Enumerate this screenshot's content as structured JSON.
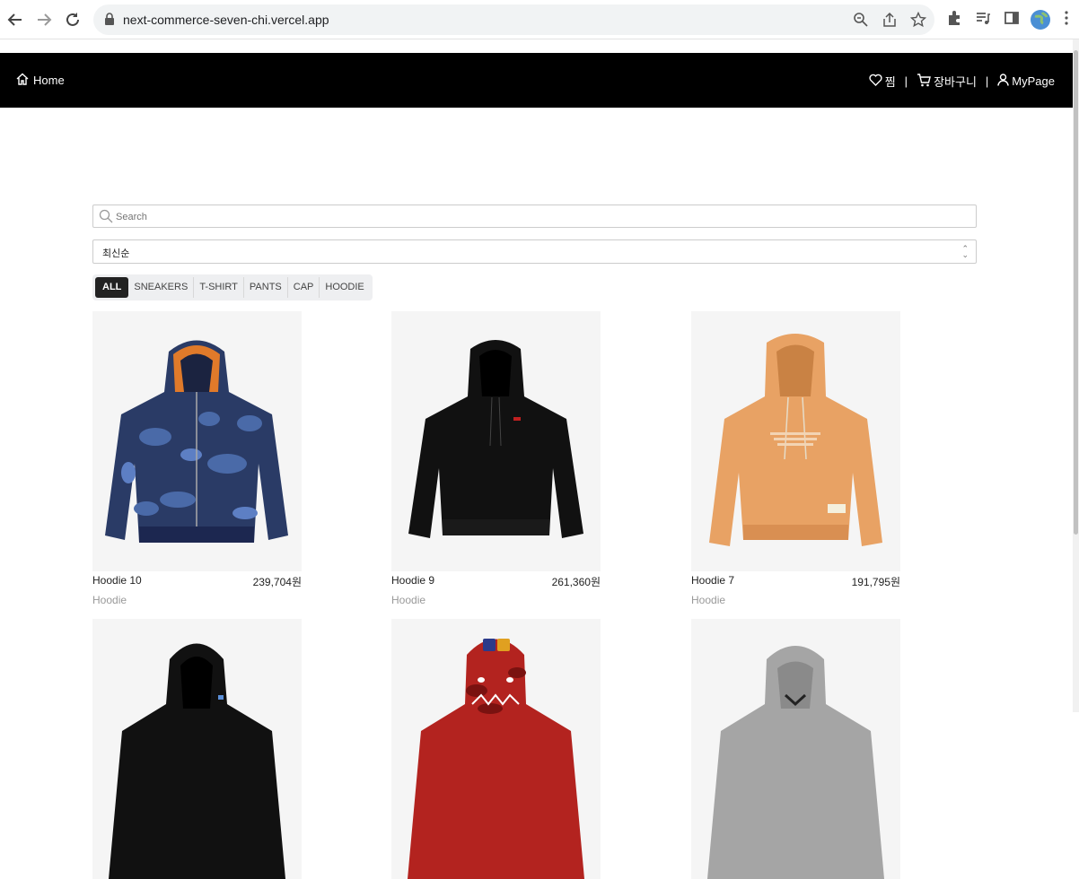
{
  "browser": {
    "url": "next-commerce-seven-chi.vercel.app"
  },
  "header": {
    "home_label": "Home",
    "wishlist_label": "찜",
    "cart_label": "장바구니",
    "mypage_label": "MyPage",
    "separator": "|"
  },
  "search": {
    "placeholder": "Search"
  },
  "sort": {
    "selected": "최신순"
  },
  "tabs": [
    {
      "label": "ALL",
      "active": true
    },
    {
      "label": "SNEAKERS"
    },
    {
      "label": "T-SHIRT"
    },
    {
      "label": "PANTS"
    },
    {
      "label": "CAP"
    },
    {
      "label": "HOODIE"
    }
  ],
  "products": [
    {
      "name": "Hoodie 10",
      "price": "239,704원",
      "category": "Hoodie",
      "image": "blue-camo-shark-hoodie"
    },
    {
      "name": "Hoodie 9",
      "price": "261,360원",
      "category": "Hoodie",
      "image": "black-hoodie"
    },
    {
      "name": "Hoodie 7",
      "price": "191,795원",
      "category": "Hoodie",
      "image": "orange-hoodie"
    },
    {
      "image": "black-hoodie"
    },
    {
      "image": "red-camo-shark-hoodie"
    },
    {
      "image": "grey-hoodie"
    }
  ],
  "colors": {
    "header_bg": "#000000",
    "tab_active_bg": "#222222",
    "card_bg": "#f5f5f5"
  }
}
